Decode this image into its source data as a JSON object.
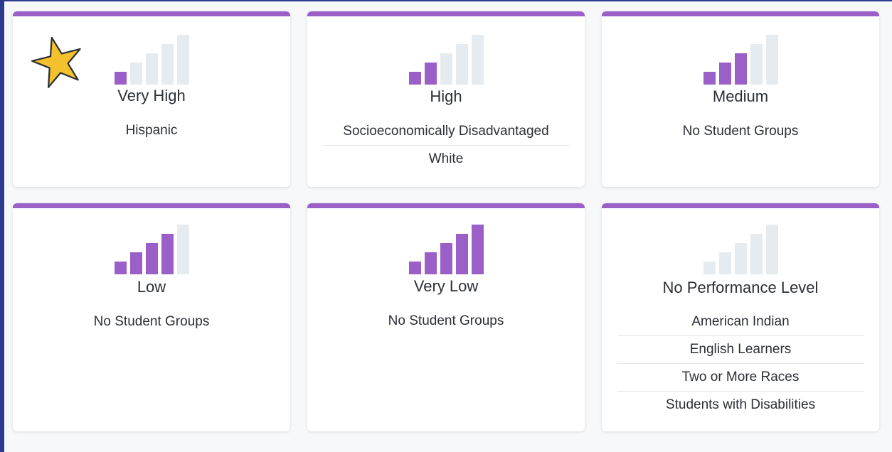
{
  "colors": {
    "accent": "#9b5fc8",
    "bar_empty": "#e6ebf0",
    "star": "#f3c12c",
    "frame": "#2b3a8f"
  },
  "cards": [
    {
      "level": "Very High",
      "filled_bars": 1,
      "groups": [
        "Hispanic"
      ],
      "starred": true
    },
    {
      "level": "High",
      "filled_bars": 2,
      "groups": [
        "Socioeconomically Disadvantaged",
        "White"
      ]
    },
    {
      "level": "Medium",
      "filled_bars": 3,
      "groups": [
        "No Student Groups"
      ]
    },
    {
      "level": "Low",
      "filled_bars": 4,
      "groups": [
        "No Student Groups"
      ]
    },
    {
      "level": "Very Low",
      "filled_bars": 5,
      "groups": [
        "No Student Groups"
      ]
    },
    {
      "level": "No Performance Level",
      "filled_bars": 0,
      "groups": [
        "American Indian",
        "English Learners",
        "Two or More Races",
        "Students with Disabilities"
      ]
    }
  ]
}
